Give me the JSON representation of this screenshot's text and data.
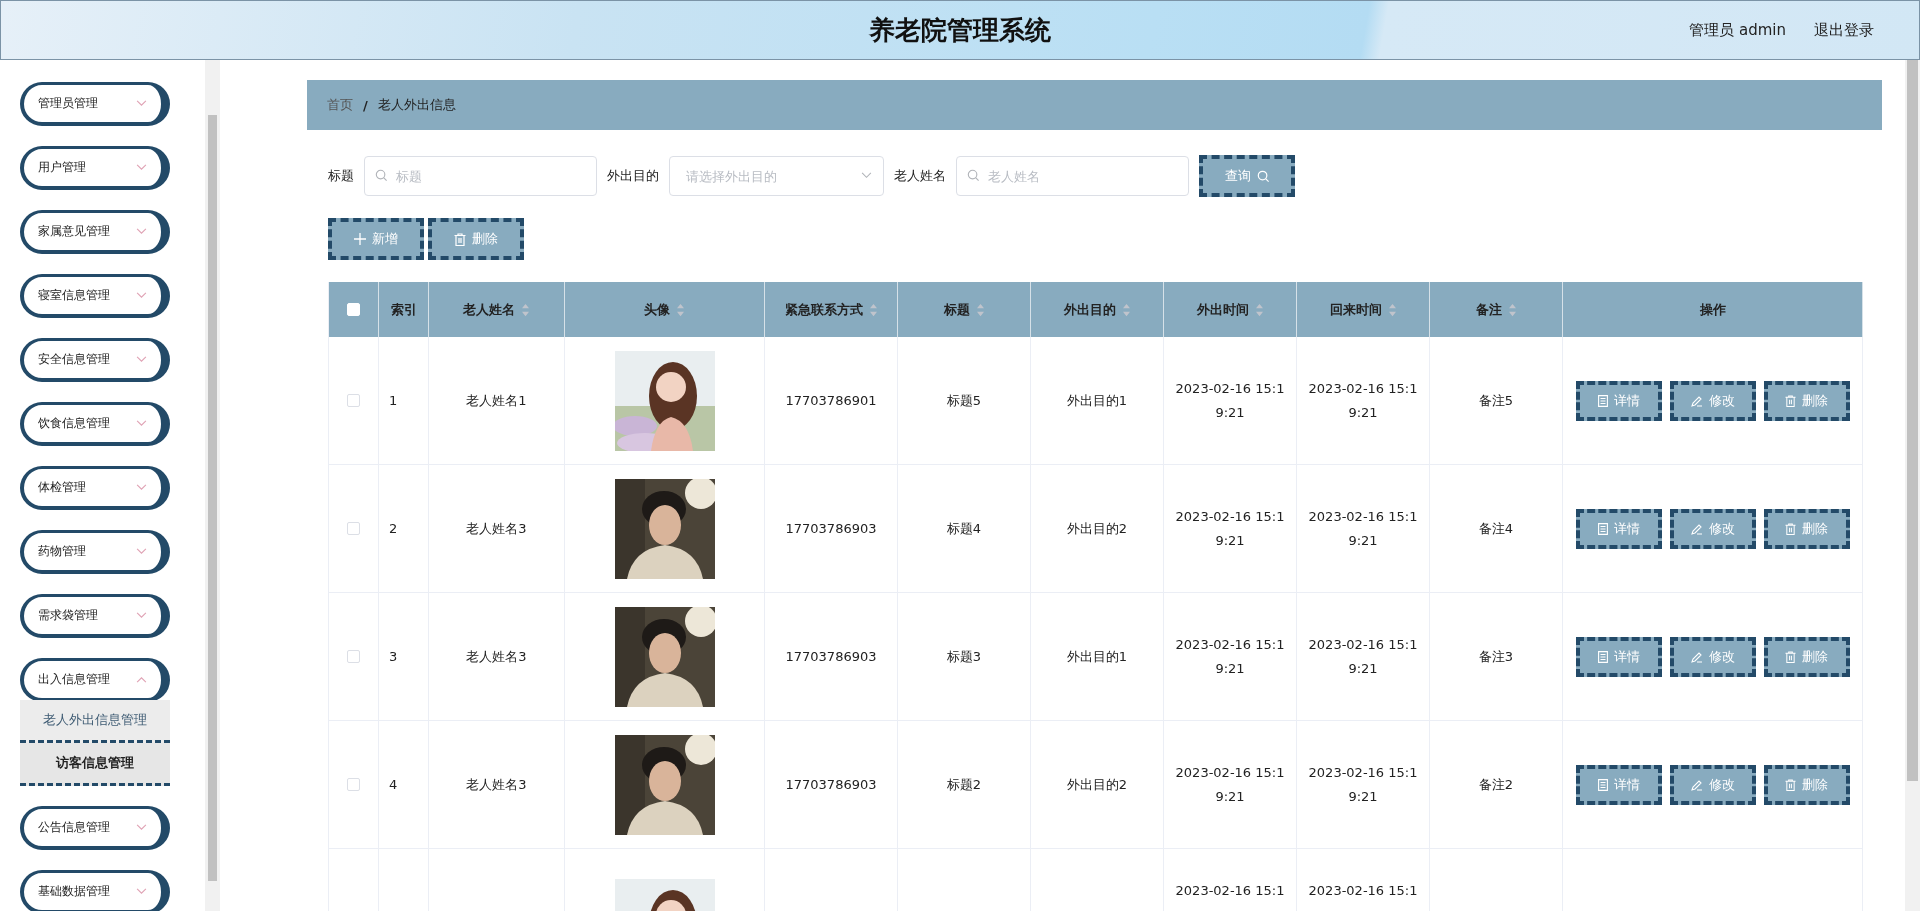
{
  "header": {
    "title": "养老院管理系统",
    "user": "管理员 admin",
    "logout": "退出登录"
  },
  "sidebar": {
    "items": [
      {
        "label": "管理员管理",
        "expanded": false
      },
      {
        "label": "用户管理",
        "expanded": false
      },
      {
        "label": "家属意见管理",
        "expanded": false
      },
      {
        "label": "寝室信息管理",
        "expanded": false
      },
      {
        "label": "安全信息管理",
        "expanded": false
      },
      {
        "label": "饮食信息管理",
        "expanded": false
      },
      {
        "label": "体检管理",
        "expanded": false
      },
      {
        "label": "药物管理",
        "expanded": false
      },
      {
        "label": "需求袋管理",
        "expanded": false
      },
      {
        "label": "出入信息管理",
        "expanded": true,
        "children": [
          {
            "label": "老人外出信息管理",
            "selected": true
          },
          {
            "label": "访客信息管理",
            "selected": false
          }
        ]
      },
      {
        "label": "公告信息管理",
        "expanded": false
      },
      {
        "label": "基础数据管理",
        "expanded": false
      }
    ]
  },
  "breadcrumb": [
    "首页",
    "/",
    "老人外出信息"
  ],
  "search": {
    "fields": [
      {
        "kind": "input",
        "label": "标题",
        "placeholder": "标题"
      },
      {
        "kind": "select",
        "label": "外出目的",
        "placeholder": "请选择外出目的"
      },
      {
        "kind": "input",
        "label": "老人姓名",
        "placeholder": "老人姓名"
      }
    ],
    "button": "查询"
  },
  "toolbar": [
    {
      "kind": "add",
      "label": "新增"
    },
    {
      "kind": "delete",
      "label": "删除"
    }
  ],
  "table": {
    "columns": [
      {
        "kind": "check",
        "checked": false
      },
      {
        "label": "索引",
        "sortable": false
      },
      {
        "label": "老人姓名",
        "sortable": true
      },
      {
        "label": "头像",
        "sortable": true
      },
      {
        "label": "紧急联系方式",
        "sortable": true
      },
      {
        "label": "标题",
        "sortable": true
      },
      {
        "label": "外出目的",
        "sortable": true
      },
      {
        "label": "外出时间",
        "sortable": true
      },
      {
        "label": "回来时间",
        "sortable": true
      },
      {
        "label": "备注",
        "sortable": true
      },
      {
        "label": "操作",
        "sortable": false
      }
    ],
    "rows": [
      {
        "checked": false,
        "index": "1",
        "name": "老人姓名1",
        "phone": "17703786901",
        "title": "标题5",
        "purpose": "外出目的1",
        "out_time": "2023-02-16 15:19:21",
        "back_time": "2023-02-16 15:19:21",
        "note": "备注5",
        "actions": [
          {
            "kind": "detail",
            "label": "详情"
          },
          {
            "kind": "edit",
            "label": "修改"
          },
          {
            "kind": "delete",
            "label": "删除"
          }
        ]
      },
      {
        "checked": false,
        "index": "2",
        "name": "老人姓名3",
        "phone": "17703786903",
        "title": "标题4",
        "purpose": "外出目的2",
        "out_time": "2023-02-16 15:19:21",
        "back_time": "2023-02-16 15:19:21",
        "note": "备注4",
        "actions": [
          {
            "kind": "detail",
            "label": "详情"
          },
          {
            "kind": "edit",
            "label": "修改"
          },
          {
            "kind": "delete",
            "label": "删除"
          }
        ]
      },
      {
        "checked": false,
        "index": "3",
        "name": "老人姓名3",
        "phone": "17703786903",
        "title": "标题3",
        "purpose": "外出目的1",
        "out_time": "2023-02-16 15:19:21",
        "back_time": "2023-02-16 15:19:21",
        "note": "备注3",
        "actions": [
          {
            "kind": "detail",
            "label": "详情"
          },
          {
            "kind": "edit",
            "label": "修改"
          },
          {
            "kind": "delete",
            "label": "删除"
          }
        ]
      },
      {
        "checked": false,
        "index": "4",
        "name": "老人姓名3",
        "phone": "17703786903",
        "title": "标题2",
        "purpose": "外出目的2",
        "out_time": "2023-02-16 15:19:21",
        "back_time": "2023-02-16 15:19:21",
        "note": "备注2",
        "actions": [
          {
            "kind": "detail",
            "label": "详情"
          },
          {
            "kind": "edit",
            "label": "修改"
          },
          {
            "kind": "delete",
            "label": "删除"
          }
        ]
      },
      {
        "out_time": "2023-02-16 15:1",
        "back_time": "2023-02-16 15:1"
      }
    ]
  }
}
